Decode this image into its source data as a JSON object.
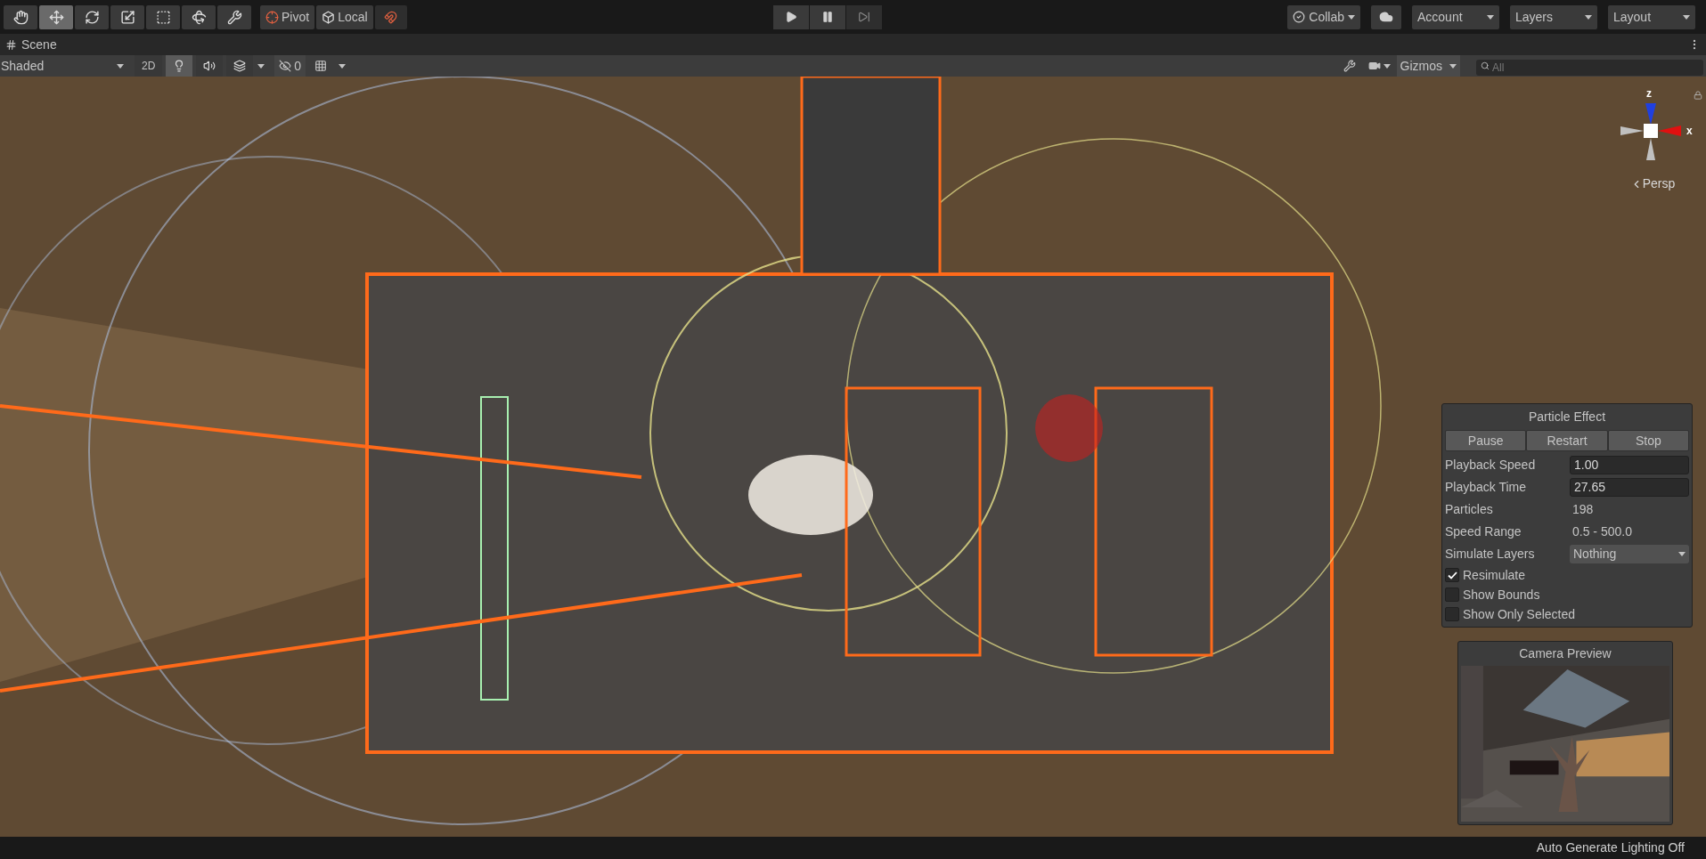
{
  "toolbar": {
    "tools": [
      {
        "kind": "hand",
        "selected": false
      },
      {
        "kind": "move",
        "selected": true
      },
      {
        "kind": "rotate",
        "selected": false
      },
      {
        "kind": "scale",
        "selected": false
      },
      {
        "kind": "rect",
        "selected": false
      },
      {
        "kind": "transform",
        "selected": false
      },
      {
        "kind": "custom",
        "selected": false
      }
    ],
    "pivot": "Pivot",
    "space": "Local",
    "menus": [
      {
        "kind": "collab",
        "label": "Collab"
      },
      {
        "kind": "cloud"
      },
      {
        "kind": "menu",
        "label": "Account"
      },
      {
        "kind": "menu",
        "label": "Layers"
      },
      {
        "kind": "menu",
        "label": "Layout"
      }
    ]
  },
  "scene_tab": {
    "title": "Scene"
  },
  "scene_toolbar": {
    "draw_mode": "Shaded",
    "mode_2d": {
      "label": "2D",
      "selected": false
    },
    "toggles": [
      {
        "kind": "lighting",
        "selected": true
      },
      {
        "kind": "audio",
        "selected": false
      },
      {
        "kind": "effects",
        "selected": false
      }
    ],
    "hidden_count": "0",
    "gizmos": "Gizmos",
    "search_placeholder": "All"
  },
  "orientation_gizmo": {
    "axes": [
      {
        "kind": "z",
        "label": "z"
      },
      {
        "kind": "x",
        "label": "x"
      }
    ],
    "projection": "Persp"
  },
  "particle_effect": {
    "title": "Particle Effect",
    "buttons": [
      "Pause",
      "Restart",
      "Stop"
    ],
    "fields": [
      {
        "kind": "input",
        "label": "Playback Speed",
        "value": "1.00"
      },
      {
        "kind": "input",
        "label": "Playback Time",
        "value": "27.65"
      },
      {
        "kind": "text",
        "label": "Particles",
        "value": "198"
      },
      {
        "kind": "text",
        "label": "Speed Range",
        "value": "0.5 - 500.0"
      },
      {
        "kind": "dropdown",
        "label": "Simulate Layers",
        "value": "Nothing"
      }
    ],
    "checkboxes": [
      {
        "label": "Resimulate",
        "checked": true
      },
      {
        "label": "Show Bounds",
        "checked": false
      },
      {
        "label": "Show Only Selected",
        "checked": false
      }
    ]
  },
  "camera_preview": {
    "title": "Camera Preview"
  },
  "status_bar": {
    "text": "Auto Generate Lighting Off"
  }
}
